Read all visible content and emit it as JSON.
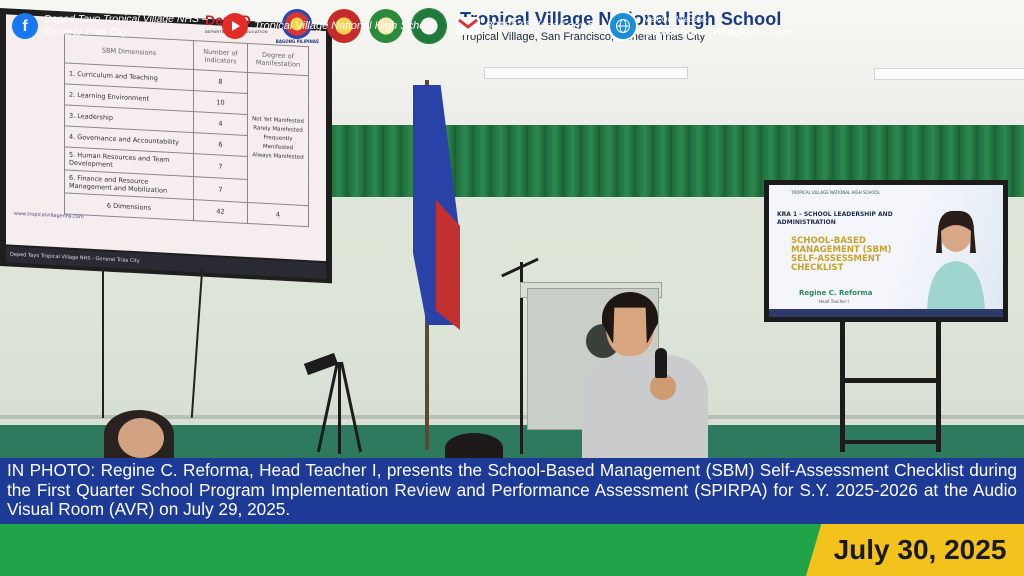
{
  "header": {
    "deped_logo": "DepED",
    "deped_sub": "DEPARTMENT OF EDUCATION",
    "bagong_pilipinas": "BAGONG PILIPINAS",
    "school_name": "Tropical Village National High School",
    "address": "Tropical Village, San Francisco, General Trias City"
  },
  "slide_left": {
    "col_headers": [
      "SBM Dimensions",
      "Number of Indicators",
      "Degree of Manifestation"
    ],
    "rows": [
      {
        "dim": "1. Curriculum and Teaching",
        "n": "8"
      },
      {
        "dim": "2. Learning Environment",
        "n": "10"
      },
      {
        "dim": "3. Leadership",
        "n": "4"
      },
      {
        "dim": "4. Governance and Accountability",
        "n": "6"
      },
      {
        "dim": "5. Human Resources and Team Development",
        "n": "7"
      },
      {
        "dim": "6. Finance and Resource Management and Mobilization",
        "n": "7"
      }
    ],
    "degrees": [
      "Not Yet Manifested",
      "Rarely Manifested",
      "Frequently Manifested",
      "Always Manifested"
    ],
    "total_label": "6 Dimensions",
    "total_n": "42",
    "total_deg": "4",
    "url": "www.tropicalvillagenhs.com",
    "footer_fb": "Deped Tayo Tropical Village NHS - General Trias City"
  },
  "slide_right": {
    "school": "TROPICAL VILLAGE NATIONAL HIGH SCHOOL",
    "kra": "KRA 1 - SCHOOL LEADERSHIP AND ADMINISTRATION",
    "title": "SCHOOL-BASED MANAGEMENT (SBM) SELF-ASSESSMENT CHECKLIST",
    "name": "Regine C. Reforma",
    "role": "Head Teacher I"
  },
  "caption": "IN PHOTO: Regine C. Reforma, Head Teacher I, presents the School-Based Management (SBM) Self-Assessment Checklist during the First Quarter School Program Implementation Review and Performance Assessment (SPIRPA) for S.Y. 2025-2026 at the Audio Visual Room (AVR) on July 29, 2025.",
  "footer": {
    "facebook": "Deped Tayo Tropical Village NHS – General Trias City",
    "youtube": "Tropical Village National High School",
    "email": "301223@deped.gov.ph",
    "website_label": "Visit Our Website:",
    "website": "www.tropicalvillagenhs.com",
    "date": "July 30, 2025"
  },
  "colors": {
    "caption_bg": "#1c3a96",
    "footer_bg": "#21a34a",
    "date_bg": "#f4c21d",
    "title": "#1b3a86"
  }
}
